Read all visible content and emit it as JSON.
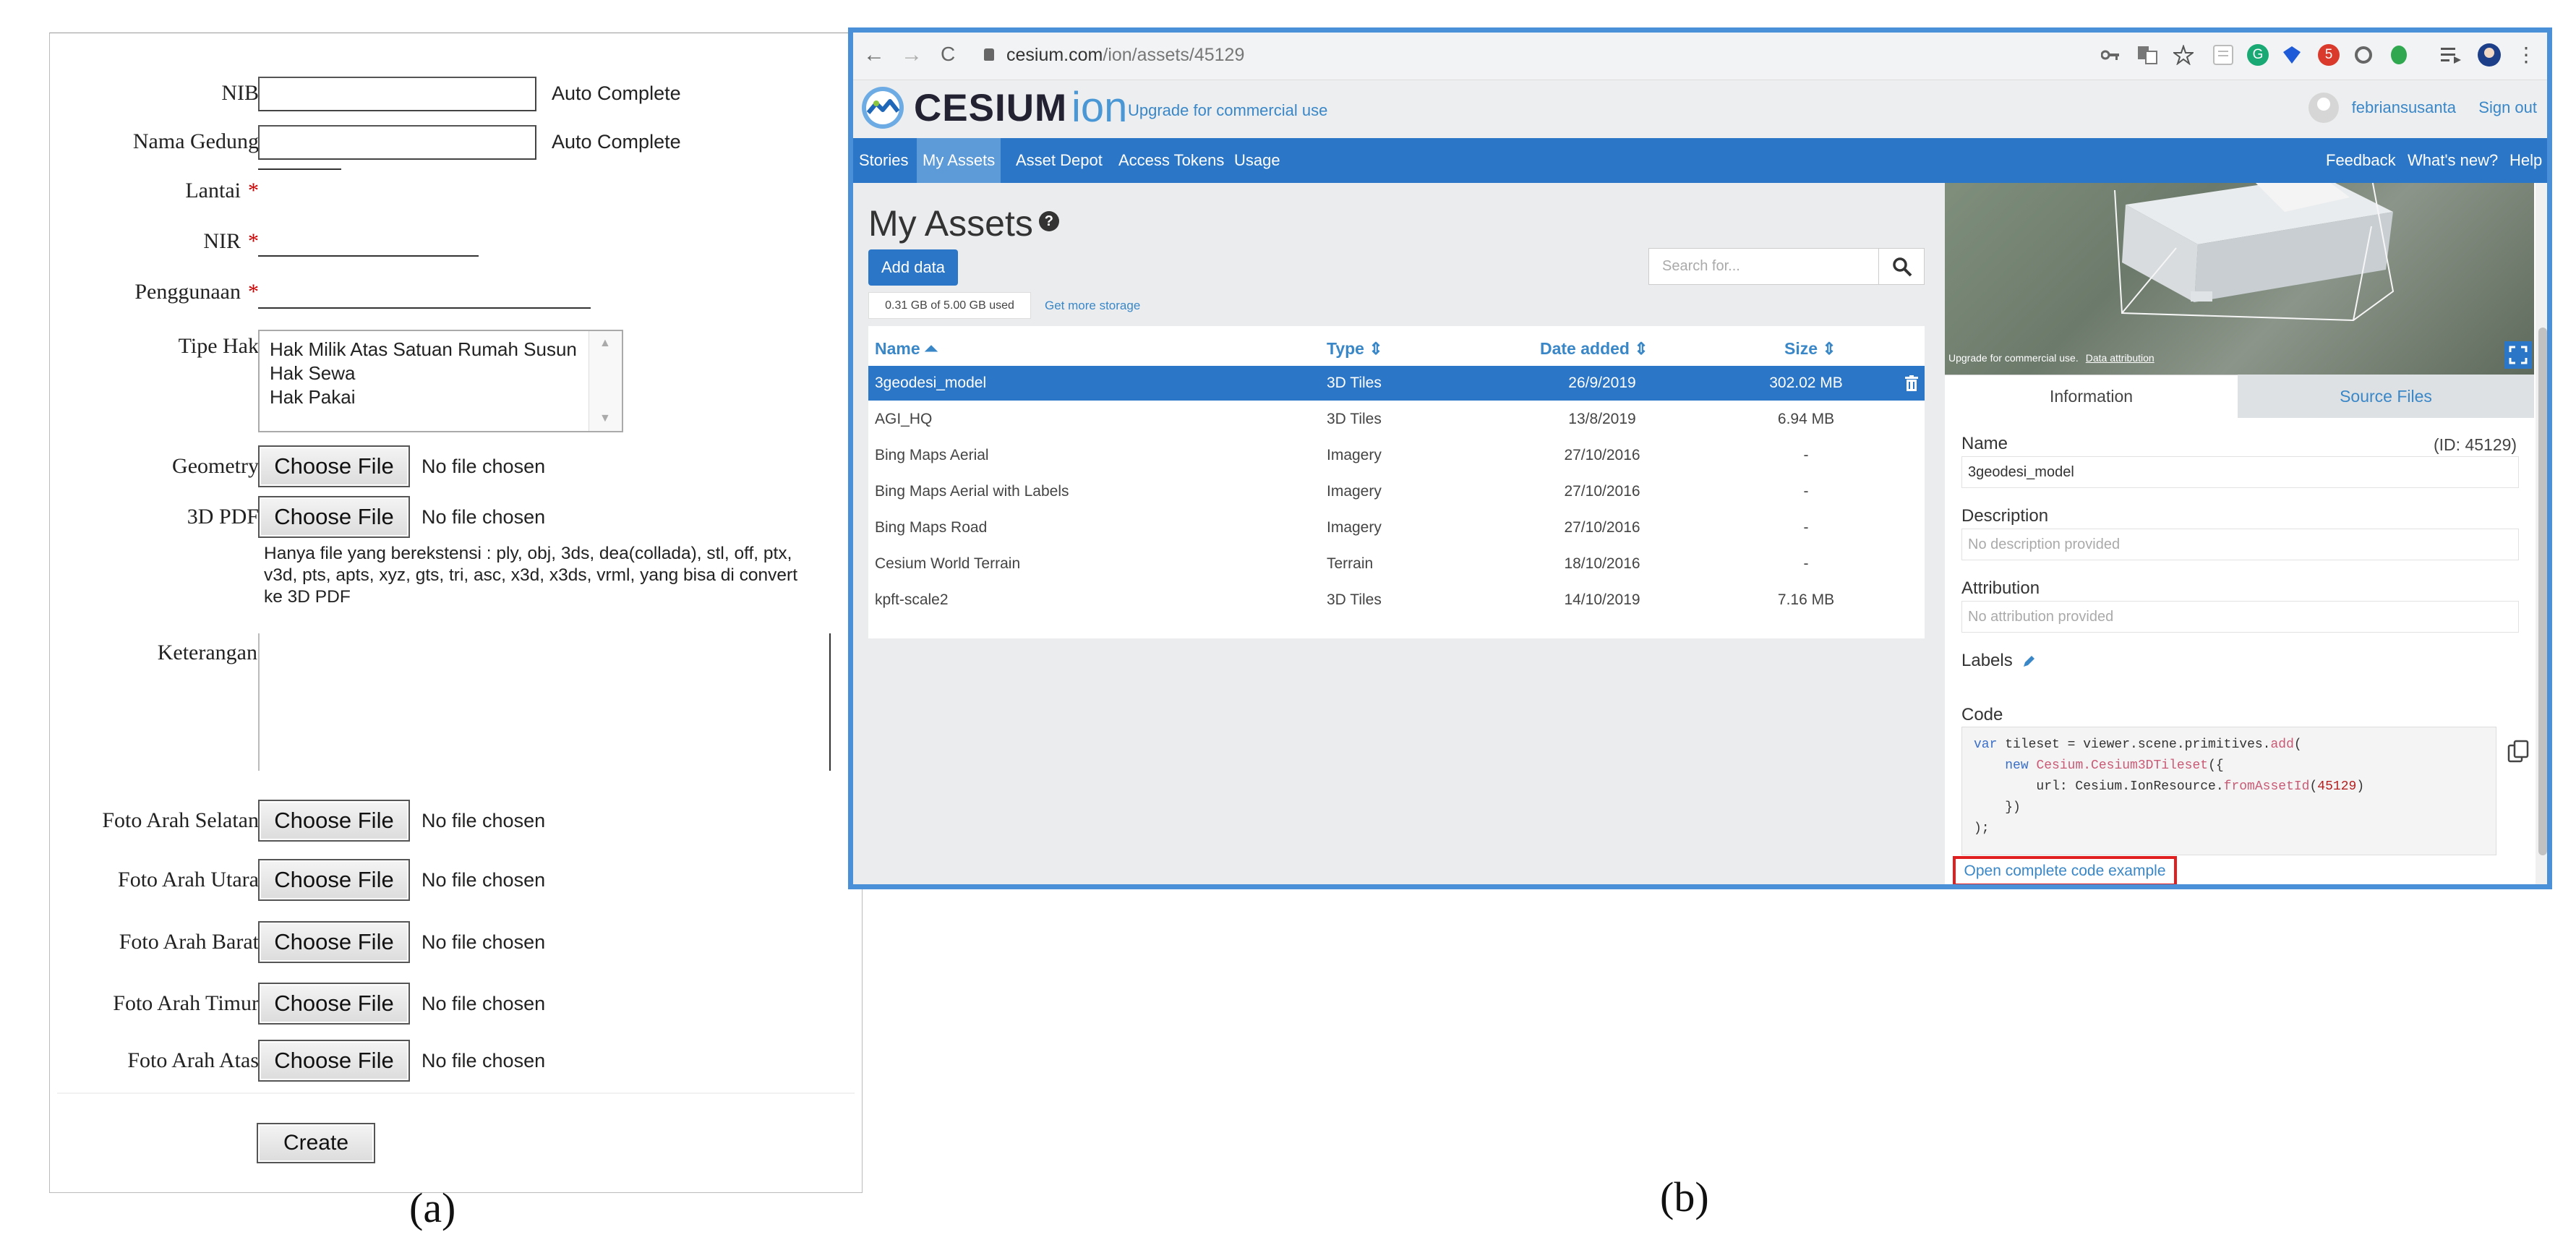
{
  "panel_a": {
    "fields": {
      "nib": {
        "label": "NIB",
        "aux": "Auto Complete"
      },
      "nama_gedung": {
        "label": "Nama Gedung",
        "aux": "Auto Complete"
      },
      "lantai": {
        "label": "Lantai",
        "required": "*"
      },
      "nir": {
        "label": "NIR",
        "required": "*"
      },
      "penggunaan": {
        "label": "Penggunaan",
        "required": "*"
      },
      "tipe_hak": {
        "label": "Tipe Hak",
        "options": [
          "Hak Milik Atas Satuan Rumah Susun",
          "Hak Sewa",
          "Hak Pakai"
        ]
      },
      "geometry": {
        "label": "Geometry"
      },
      "pdf3d": {
        "label": "3D PDF"
      },
      "note": "Hanya file yang berekstensi : ply, obj, 3ds, dea(collada), stl, off, ptx, v3d, pts, apts, xyz, gts, tri, asc, x3d, x3ds, vrml, yang bisa di convert ke 3D PDF",
      "keterangan": {
        "label": "Keterangan"
      },
      "foto_selatan": {
        "label": "Foto Arah Selatan"
      },
      "foto_utara": {
        "label": "Foto Arah Utara"
      },
      "foto_barat": {
        "label": "Foto Arah Barat"
      },
      "foto_timur": {
        "label": "Foto Arah Timur"
      },
      "foto_atas": {
        "label": "Foto Arah Atas"
      }
    },
    "file_button_label": "Choose File",
    "no_file_text": "No file chosen",
    "create_label": "Create"
  },
  "captions": {
    "a": "(a)",
    "b": "(b)"
  },
  "browser": {
    "url_host": "cesium.com",
    "url_path": "/ion/assets/45129",
    "back": "←",
    "forward": "→",
    "reload": "C",
    "menu": "⋮",
    "extension_badge": "5"
  },
  "header": {
    "brand": "CESIUM",
    "product": "ion",
    "upgrade": "Upgrade for commercial use",
    "username": "febriansusanta",
    "signout": "Sign out"
  },
  "nav": {
    "left": [
      "Stories",
      "My Assets",
      "Asset Depot",
      "Access Tokens",
      "Usage"
    ],
    "active": "My Assets",
    "right": [
      "Feedback",
      "What's new?",
      "Help"
    ]
  },
  "assets": {
    "title": "My Assets",
    "help_icon": "?",
    "add_data": "Add data",
    "storage": "0.31 GB of 5.00 GB used",
    "more_storage": "Get more storage",
    "search_placeholder": "Search for...",
    "columns": [
      "Name ⏶",
      "Type ⇕",
      "Date added ⇕",
      "Size ⇕"
    ],
    "rows": [
      {
        "name": "3geodesi_model",
        "type": "3D Tiles",
        "date": "26/9/2019",
        "size": "302.02 MB",
        "selected": true
      },
      {
        "name": "AGI_HQ",
        "type": "3D Tiles",
        "date": "13/8/2019",
        "size": "6.94 MB"
      },
      {
        "name": "Bing Maps Aerial",
        "type": "Imagery",
        "date": "27/10/2016",
        "size": "-"
      },
      {
        "name": "Bing Maps Aerial with Labels",
        "type": "Imagery",
        "date": "27/10/2016",
        "size": "-"
      },
      {
        "name": "Bing Maps Road",
        "type": "Imagery",
        "date": "27/10/2016",
        "size": "-"
      },
      {
        "name": "Cesium World Terrain",
        "type": "Terrain",
        "date": "18/10/2016",
        "size": "-"
      },
      {
        "name": "kpft-scale2",
        "type": "3D Tiles",
        "date": "14/10/2019",
        "size": "7.16 MB"
      }
    ]
  },
  "details": {
    "viewer_note": "Upgrade for commercial use.",
    "viewer_attr": "Data attribution",
    "tab_info": "Information",
    "tab_source": "Source Files",
    "name_label": "Name",
    "id_text": "(ID:  45129)",
    "name_value": "3geodesi_model",
    "desc_label": "Description",
    "desc_placeholder": "No description provided",
    "attr_label": "Attribution",
    "attr_placeholder": "No attribution provided",
    "labels_label": "Labels",
    "code_label": "Code",
    "open_example": "Open complete code example"
  }
}
